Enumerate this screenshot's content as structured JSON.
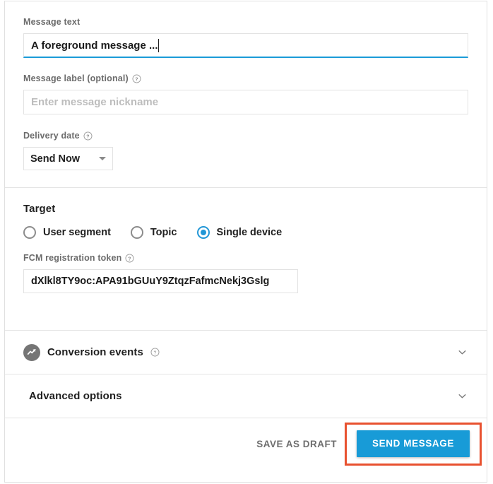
{
  "form": {
    "message_text": {
      "label": "Message text",
      "value": "A foreground message ...",
      "focused": true
    },
    "message_label": {
      "label": "Message label (optional)",
      "placeholder": "Enter message nickname",
      "value": "",
      "help_icon": "help-circle-icon"
    },
    "delivery_date": {
      "label": "Delivery date",
      "selected": "Send Now",
      "options": [
        "Send Now"
      ],
      "help_icon": "help-circle-icon",
      "dropdown_icon": "chevron-down-icon"
    }
  },
  "target": {
    "title": "Target",
    "options": [
      {
        "label": "User segment",
        "selected": false
      },
      {
        "label": "Topic",
        "selected": false
      },
      {
        "label": "Single device",
        "selected": true
      }
    ],
    "token_field": {
      "label": "FCM registration token",
      "value": "dXlkl8TY9oc:APA91bGUuY9ZtqzFafmcNekj3Gslg",
      "help_icon": "help-circle-icon"
    }
  },
  "sections": [
    {
      "title": "Conversion events",
      "icon": "analytics-trending-icon",
      "help_icon": "help-circle-icon",
      "expand_icon": "chevron-down-icon",
      "expanded": false
    },
    {
      "title": "Advanced options",
      "icon": null,
      "help_icon": null,
      "expand_icon": "chevron-down-icon",
      "expanded": false
    }
  ],
  "footer": {
    "save_draft_label": "SAVE AS DRAFT",
    "send_label": "SEND MESSAGE",
    "highlighted": "send-message-button"
  },
  "colors": {
    "accent_blue": "#189bd7",
    "focus_underline": "#1b9bd8",
    "radio_selected": "#2196d6",
    "annotation_red": "#e8512f",
    "icon_gray": "#757575",
    "label_gray": "#6b6b6b",
    "border_gray": "#e3e3e3"
  }
}
